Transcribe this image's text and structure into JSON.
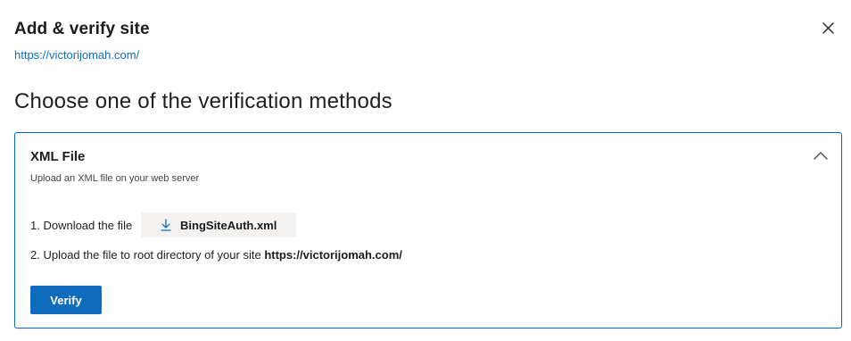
{
  "dialog": {
    "title": "Add & verify site",
    "site_url": "https://victorijomah.com/",
    "close_icon": "close-icon"
  },
  "main": {
    "heading": "Choose one of the verification methods"
  },
  "method": {
    "title": "XML File",
    "subtitle": "Upload an XML file on your web server",
    "expanded": true,
    "collapse_icon": "chevron-up-icon",
    "step1_label": "1. Download the file",
    "download_label": "BingSiteAuth.xml",
    "download_icon": "download-icon",
    "step2_text": "2. Upload the file to root directory of your site",
    "step2_url": "https://victorijomah.com/",
    "verify_label": "Verify"
  },
  "colors": {
    "accent": "#0f6cbd",
    "download_bg": "#f3f2f1"
  }
}
